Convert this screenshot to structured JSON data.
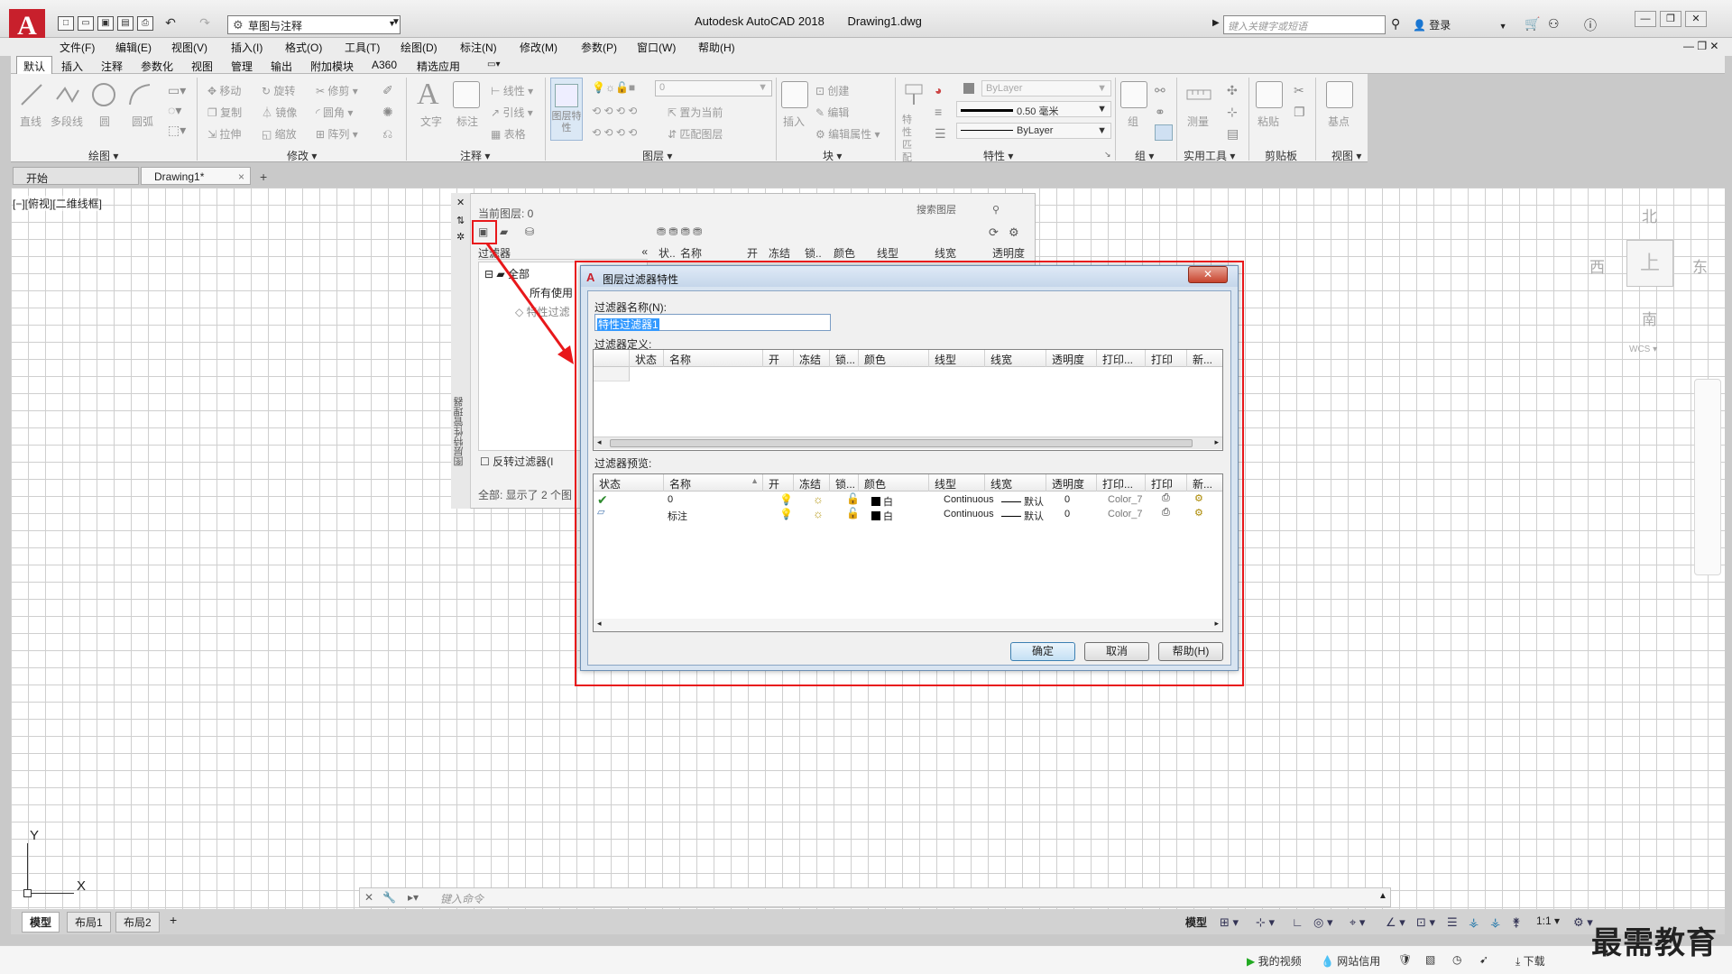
{
  "titlebar": {
    "app_name": "Autodesk AutoCAD 2018",
    "document": "Drawing1.dwg",
    "workspace": "草图与注释",
    "search_placeholder": "键入关键字或短语",
    "login": "登录",
    "logo": "A"
  },
  "menus": [
    "文件(F)",
    "编辑(E)",
    "视图(V)",
    "插入(I)",
    "格式(O)",
    "工具(T)",
    "绘图(D)",
    "标注(N)",
    "修改(M)",
    "参数(P)",
    "窗口(W)",
    "帮助(H)"
  ],
  "ribbon_tabs": [
    "默认",
    "插入",
    "注释",
    "参数化",
    "视图",
    "管理",
    "输出",
    "附加模块",
    "A360",
    "精选应用"
  ],
  "ribbon": {
    "draw": {
      "title": "绘图",
      "tools": [
        "直线",
        "多段线",
        "圆",
        "圆弧"
      ]
    },
    "modify": {
      "title": "修改",
      "tools": [
        "移动",
        "旋转",
        "修剪",
        "复制",
        "镜像",
        "圆角",
        "拉伸",
        "缩放",
        "阵列"
      ]
    },
    "annotation": {
      "title": "注释",
      "tools": [
        "文字",
        "标注",
        "线性",
        "引线",
        "表格"
      ]
    },
    "layers": {
      "title": "图层",
      "tools": [
        "图层特性",
        "置为当前",
        "匹配图层"
      ],
      "current": "0"
    },
    "block": {
      "title": "块",
      "tools": [
        "插入",
        "创建",
        "编辑",
        "编辑属性"
      ]
    },
    "properties": {
      "title": "特性",
      "match": "特性匹配",
      "color": "ByLayer",
      "lineweight": "0.50 毫米",
      "linetype": "ByLayer"
    },
    "groups": {
      "title": "组",
      "tool": "组"
    },
    "utilities": {
      "title": "实用工具",
      "tool": "测量"
    },
    "clipboard": {
      "title": "剪贴板",
      "tool": "粘贴"
    },
    "view": {
      "title": "视图",
      "tool": "基点"
    }
  },
  "doc_tabs": [
    "开始",
    "Drawing1*"
  ],
  "viewport_label": "[−][俯视][二维线框]",
  "viewcube": {
    "north": "北",
    "south": "南",
    "east": "东",
    "west": "西",
    "top": "上",
    "wcs": "WCS"
  },
  "ucs": {
    "x": "X",
    "y": "Y"
  },
  "command_placeholder": "键入命令",
  "layout_tabs": [
    "模型",
    "布局1",
    "布局2"
  ],
  "status": {
    "model": "模型",
    "scale": "1:1"
  },
  "os_bar": {
    "items": [
      "我的视频",
      "网站信用",
      "下载"
    ]
  },
  "watermark": "最需教育",
  "layer_manager": {
    "side_title": "图层特性管理器",
    "current_layer": "当前图层: 0",
    "search": "搜索图层",
    "filters_header": "过滤器",
    "tree": [
      "全部",
      "所有使用",
      "特性过滤"
    ],
    "invert": "反转过滤器(I",
    "summary": "全部: 显示了 2 个图",
    "columns": [
      "状..",
      "名称",
      "开",
      "冻结",
      "锁..",
      "颜色",
      "线型",
      "线宽",
      "透明度"
    ]
  },
  "dialog": {
    "title": "图层过滤器特性",
    "name_label": "过滤器名称(N):",
    "name_value": "特性过滤器1",
    "definition_label": "过滤器定义:",
    "preview_label": "过滤器预览:",
    "def_columns": [
      "状态",
      "名称",
      "开",
      "冻结",
      "锁...",
      "颜色",
      "线型",
      "线宽",
      "透明度",
      "打印...",
      "打印",
      "新..."
    ],
    "prev_columns": [
      "状态",
      "名称",
      "开",
      "冻结",
      "锁...",
      "颜色",
      "线型",
      "线宽",
      "透明度",
      "打印...",
      "打印",
      "新..."
    ],
    "rows": [
      {
        "name": "0",
        "color": "白",
        "linetype": "Continuous",
        "lineweight": "默认",
        "transparency": "0",
        "plotstyle": "Color_7"
      },
      {
        "name": "标注",
        "color": "白",
        "linetype": "Continuous",
        "lineweight": "默认",
        "transparency": "0",
        "plotstyle": "Color_7"
      }
    ],
    "buttons": {
      "ok": "确定",
      "cancel": "取消",
      "help": "帮助(H)"
    }
  },
  "colors": {
    "highlight": "#e8181b",
    "brand": "#c8202c",
    "selection": "#3399ff"
  }
}
